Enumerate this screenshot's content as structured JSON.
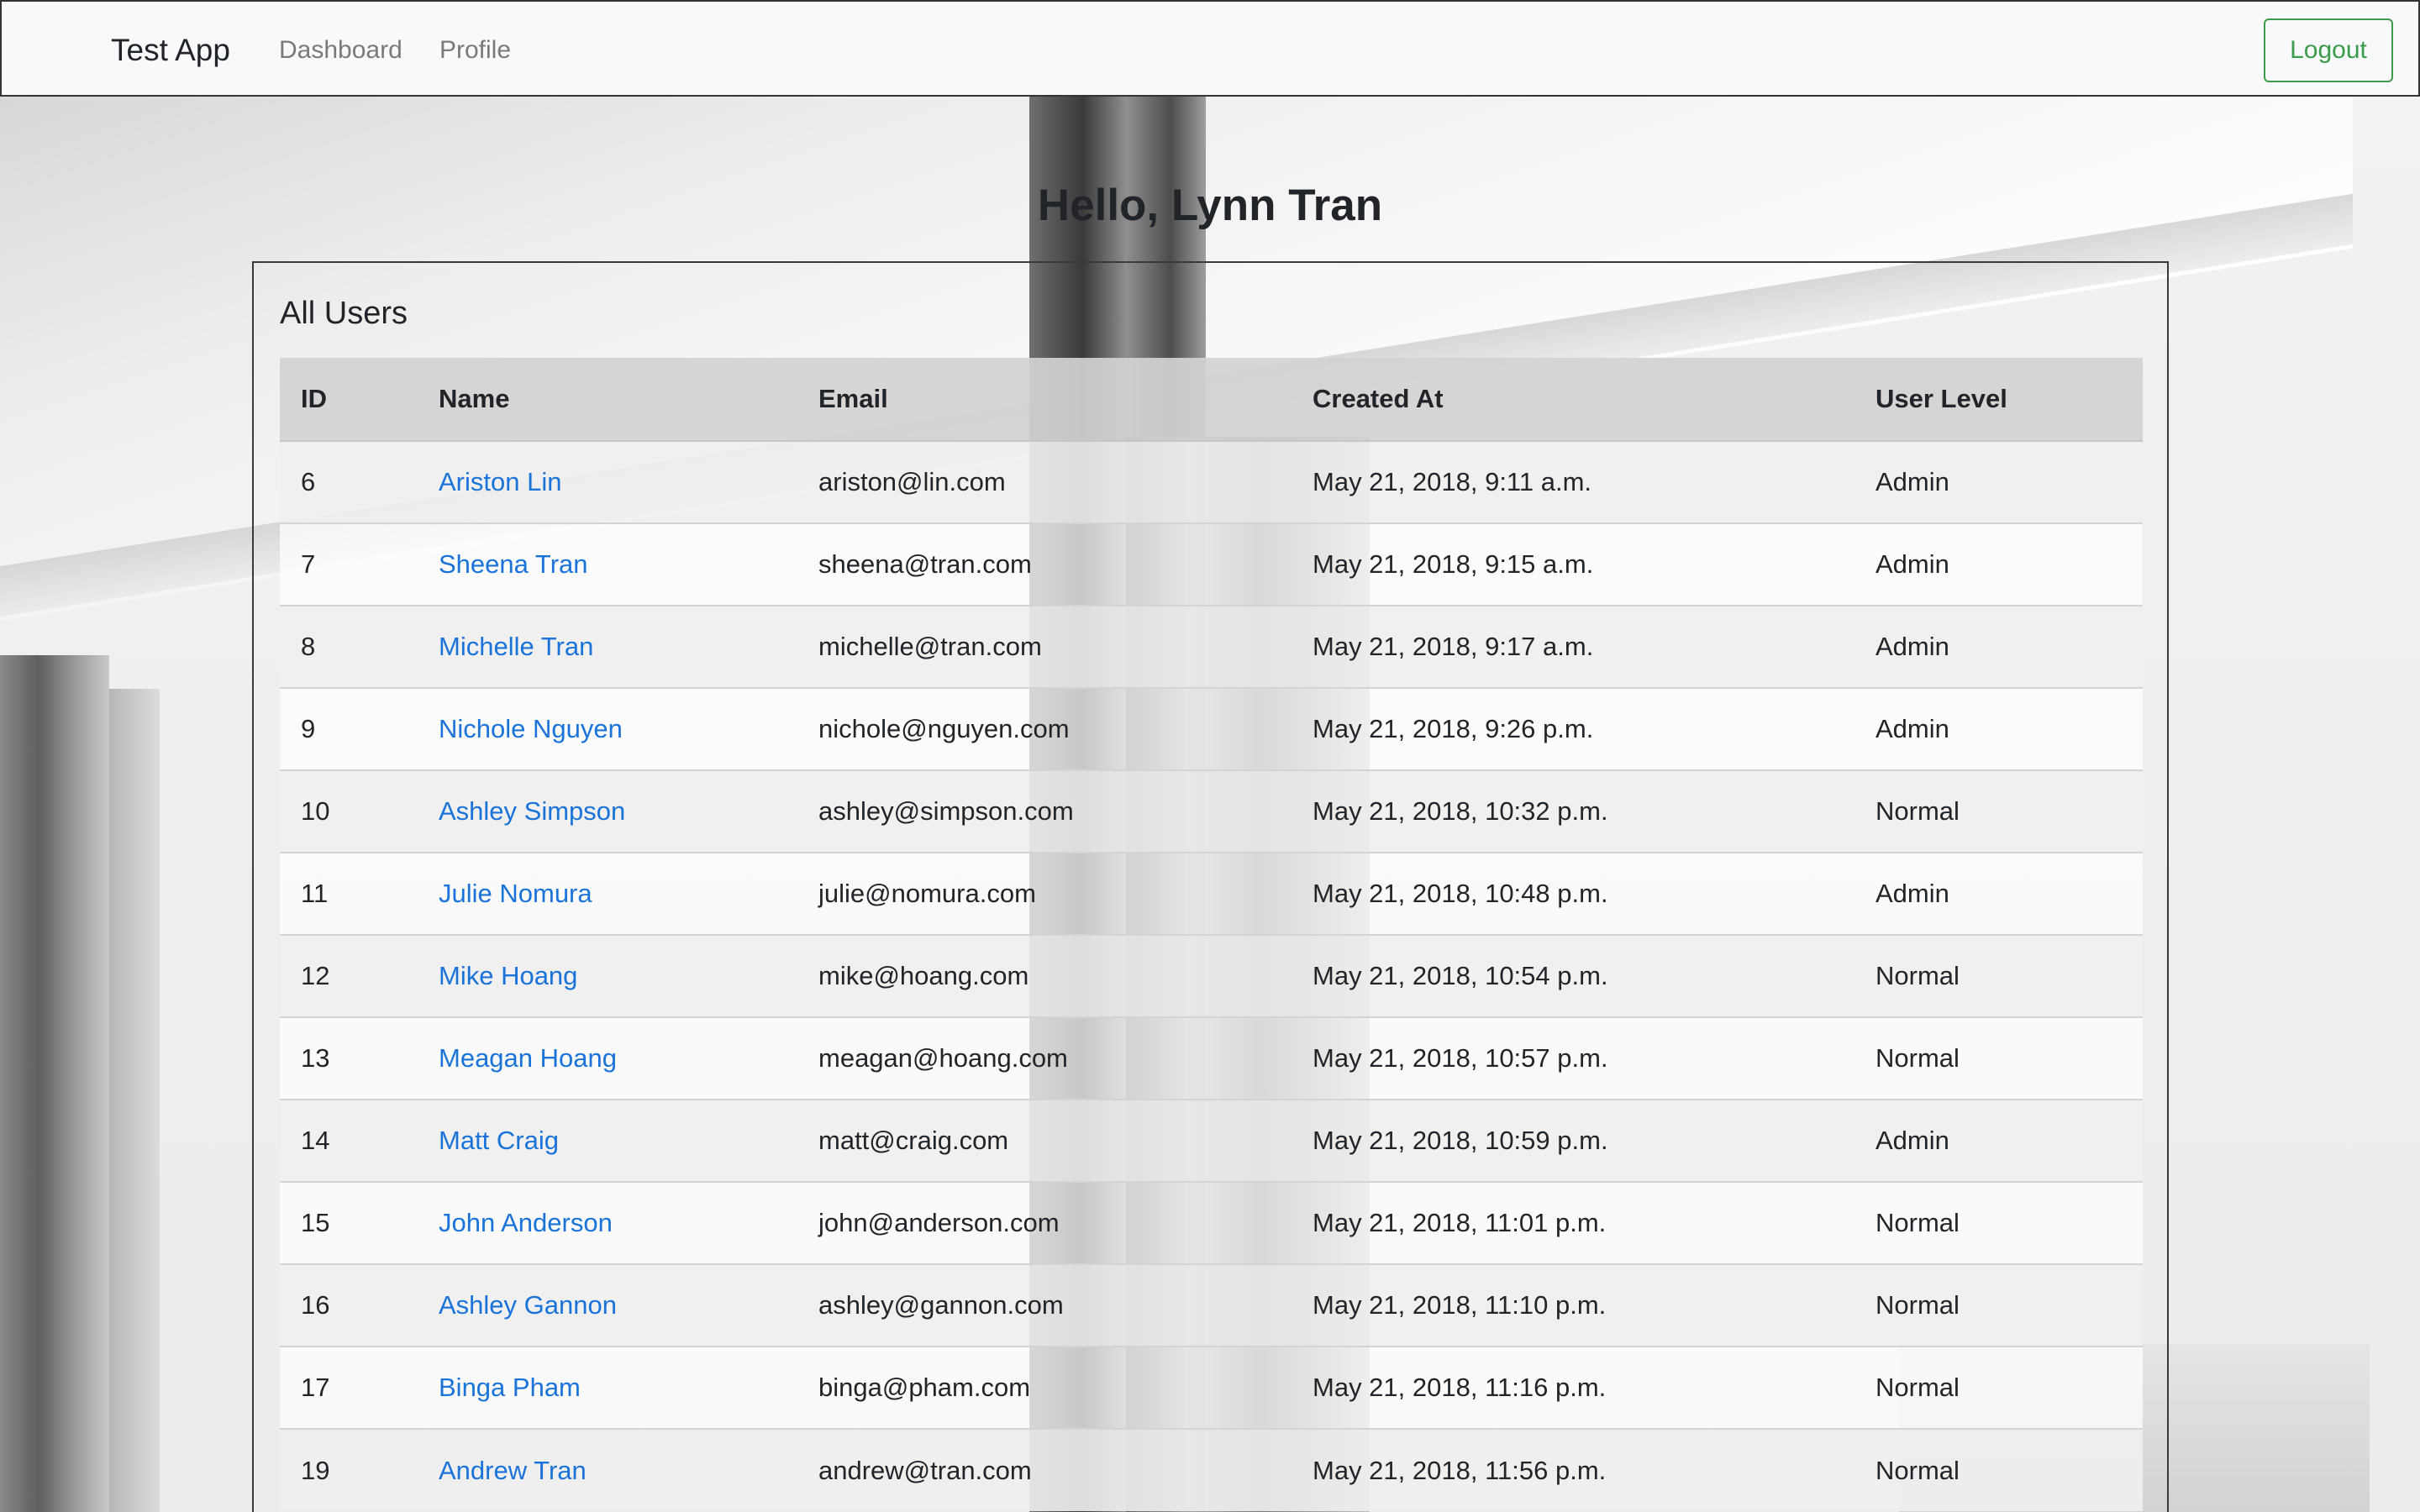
{
  "navbar": {
    "brand": "Test App",
    "links": [
      "Dashboard",
      "Profile"
    ],
    "logout_label": "Logout"
  },
  "greeting": "Hello, Lynn Tran",
  "users_card": {
    "title": "All Users",
    "columns": [
      "ID",
      "Name",
      "Email",
      "Created At",
      "User Level"
    ],
    "rows": [
      {
        "id": "6",
        "name": "Ariston Lin",
        "email": "ariston@lin.com",
        "created_at": "May 21, 2018, 9:11 a.m.",
        "level": "Admin"
      },
      {
        "id": "7",
        "name": "Sheena Tran",
        "email": "sheena@tran.com",
        "created_at": "May 21, 2018, 9:15 a.m.",
        "level": "Admin"
      },
      {
        "id": "8",
        "name": "Michelle Tran",
        "email": "michelle@tran.com",
        "created_at": "May 21, 2018, 9:17 a.m.",
        "level": "Admin"
      },
      {
        "id": "9",
        "name": "Nichole Nguyen",
        "email": "nichole@nguyen.com",
        "created_at": "May 21, 2018, 9:26 p.m.",
        "level": "Admin"
      },
      {
        "id": "10",
        "name": "Ashley Simpson",
        "email": "ashley@simpson.com",
        "created_at": "May 21, 2018, 10:32 p.m.",
        "level": "Normal"
      },
      {
        "id": "11",
        "name": "Julie Nomura",
        "email": "julie@nomura.com",
        "created_at": "May 21, 2018, 10:48 p.m.",
        "level": "Admin"
      },
      {
        "id": "12",
        "name": "Mike Hoang",
        "email": "mike@hoang.com",
        "created_at": "May 21, 2018, 10:54 p.m.",
        "level": "Normal"
      },
      {
        "id": "13",
        "name": "Meagan Hoang",
        "email": "meagan@hoang.com",
        "created_at": "May 21, 2018, 10:57 p.m.",
        "level": "Normal"
      },
      {
        "id": "14",
        "name": "Matt Craig",
        "email": "matt@craig.com",
        "created_at": "May 21, 2018, 10:59 p.m.",
        "level": "Admin"
      },
      {
        "id": "15",
        "name": "John Anderson",
        "email": "john@anderson.com",
        "created_at": "May 21, 2018, 11:01 p.m.",
        "level": "Normal"
      },
      {
        "id": "16",
        "name": "Ashley Gannon",
        "email": "ashley@gannon.com",
        "created_at": "May 21, 2018, 11:10 p.m.",
        "level": "Normal"
      },
      {
        "id": "17",
        "name": "Binga Pham",
        "email": "binga@pham.com",
        "created_at": "May 21, 2018, 11:16 p.m.",
        "level": "Normal"
      },
      {
        "id": "19",
        "name": "Andrew Tran",
        "email": "andrew@tran.com",
        "created_at": "May 21, 2018, 11:56 p.m.",
        "level": "Normal"
      }
    ]
  },
  "colors": {
    "link": "#1a73d9",
    "logout_accent": "#3a9b4b",
    "navbar_bg": "#f8f9fa"
  }
}
